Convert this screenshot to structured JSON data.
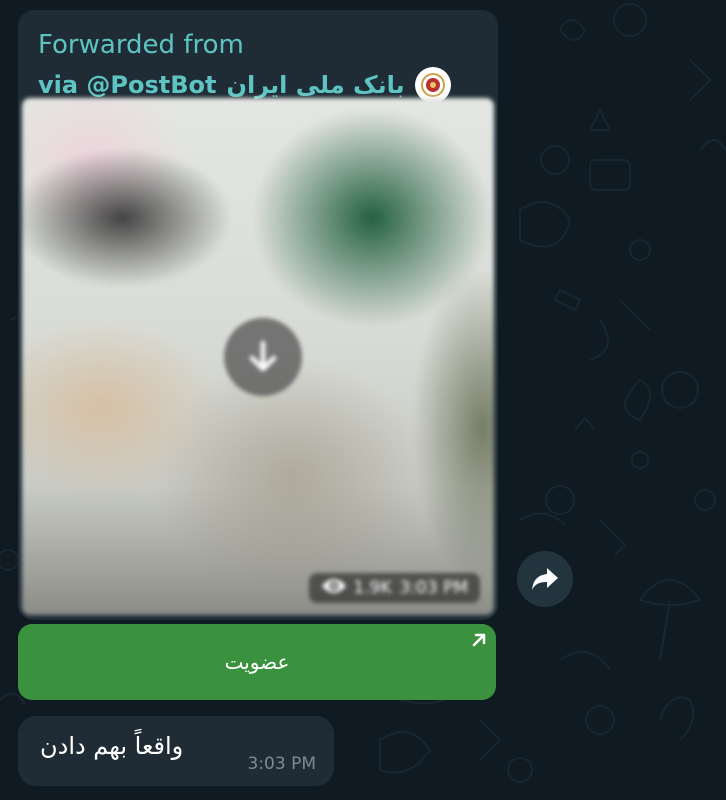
{
  "forward": {
    "header": "Forwarded from",
    "source_name": "بانک ملی ایران",
    "via": "via @PostBot",
    "avatar_icon": "bank-logo-icon"
  },
  "media": {
    "download_icon": "download-arrow-icon",
    "views_icon": "eye-icon",
    "views": "1.9K",
    "time": "3:03 PM"
  },
  "inline_button": {
    "label": "عضویت",
    "link_icon": "external-link-arrow-icon"
  },
  "share_icon": "share-arrow-icon",
  "reply": {
    "text": "واقعاً بهم دادن",
    "time": "3:03 PM"
  },
  "colors": {
    "accent_teal": "#5ec4c2",
    "button_green": "#3b923e",
    "bubble_bg": "#1f2c36",
    "chat_bg": "#0f1a22"
  }
}
